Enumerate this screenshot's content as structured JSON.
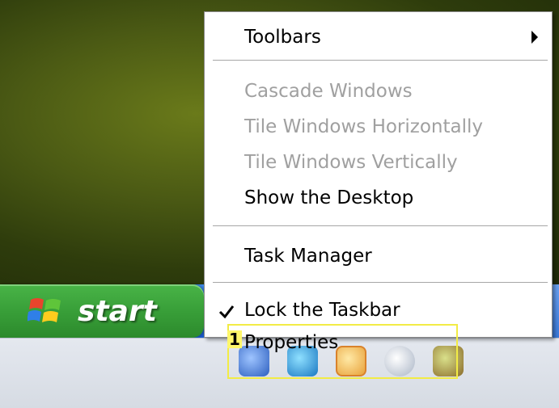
{
  "taskbar": {
    "start_label": "start"
  },
  "context_menu": {
    "items": [
      {
        "label": "Toolbars",
        "enabled": true,
        "has_submenu": true
      },
      {
        "label": "Cascade Windows",
        "enabled": false
      },
      {
        "label": "Tile Windows Horizontally",
        "enabled": false
      },
      {
        "label": "Tile Windows Vertically",
        "enabled": false
      },
      {
        "label": "Show the Desktop",
        "enabled": true
      },
      {
        "label": "Task Manager",
        "enabled": true
      },
      {
        "label": "Lock the Taskbar",
        "enabled": true,
        "checked": true
      },
      {
        "label": "Properties",
        "enabled": true
      }
    ]
  },
  "annotation": {
    "step_number": "1"
  },
  "icons": {
    "start_logo": "windows-logo-icon",
    "submenu_arrow": "chevron-right-icon",
    "check": "checkmark-icon"
  },
  "colors": {
    "start_button": "#3aa13a",
    "taskbar": "#2a6fe0",
    "highlight": "#f2ec45",
    "disabled_text": "#a0a0a0"
  }
}
